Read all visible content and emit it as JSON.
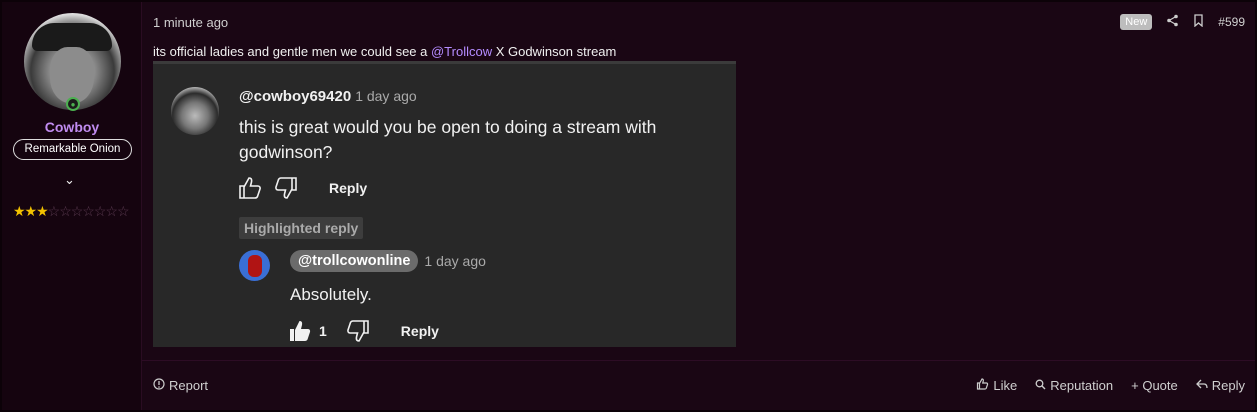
{
  "user": {
    "name": "Cowboy",
    "title_badge": "Remarkable Onion",
    "rating_stars_filled": 3,
    "rating_stars_total": 10
  },
  "post": {
    "time": "1 minute ago",
    "new_label": "New",
    "number": "#599",
    "message_prefix": "its official ladies and gentle men we could see a ",
    "mention": "@Trollcow",
    "message_suffix": " X Godwinson stream"
  },
  "embed": {
    "comment": {
      "handle": "@cowboy69420",
      "time": "1 day ago",
      "text": "this is great would you be open to doing a stream with godwinson?",
      "reply_label": "Reply"
    },
    "highlight_label": "Highlighted reply",
    "reply": {
      "handle": "@trollcowonline",
      "time": "1 day ago",
      "text": "Absolutely.",
      "likes": "1",
      "reply_label": "Reply"
    }
  },
  "footer": {
    "report": "Report",
    "like": "Like",
    "reputation": "Reputation",
    "quote": "+ Quote",
    "reply": "Reply"
  },
  "colors": {
    "background": "#1a0614",
    "username": "#c08cf0",
    "mention": "#b48cff",
    "star": "#f2c200",
    "embed_bg": "#282828"
  }
}
